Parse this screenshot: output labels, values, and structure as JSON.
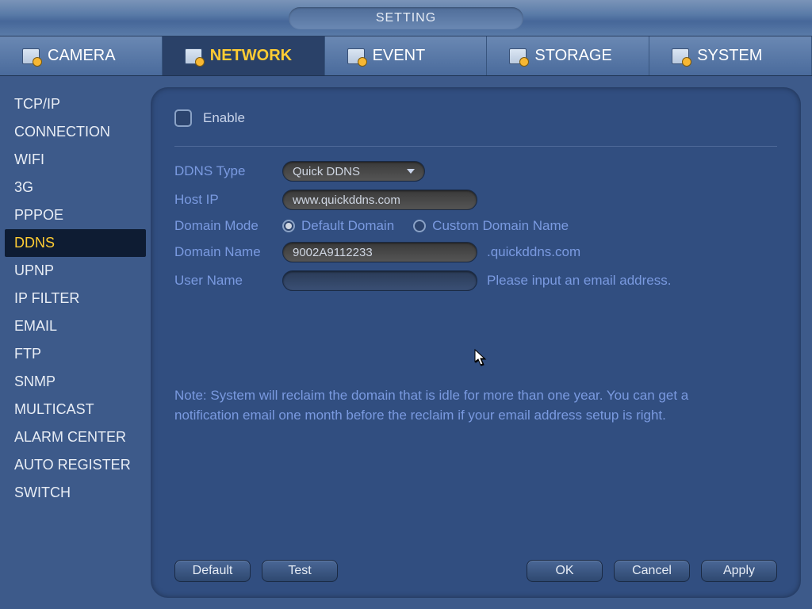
{
  "title": "SETTING",
  "tabs": [
    {
      "label": "CAMERA"
    },
    {
      "label": "NETWORK"
    },
    {
      "label": "EVENT"
    },
    {
      "label": "STORAGE"
    },
    {
      "label": "SYSTEM"
    }
  ],
  "active_tab": 1,
  "sidebar": {
    "items": [
      {
        "label": "TCP/IP"
      },
      {
        "label": "CONNECTION"
      },
      {
        "label": "WIFI"
      },
      {
        "label": "3G"
      },
      {
        "label": "PPPOE"
      },
      {
        "label": "DDNS"
      },
      {
        "label": "UPNP"
      },
      {
        "label": "IP FILTER"
      },
      {
        "label": "EMAIL"
      },
      {
        "label": "FTP"
      },
      {
        "label": "SNMP"
      },
      {
        "label": "MULTICAST"
      },
      {
        "label": "ALARM CENTER"
      },
      {
        "label": "AUTO REGISTER"
      },
      {
        "label": "SWITCH"
      }
    ],
    "active_index": 5
  },
  "form": {
    "enable_label": "Enable",
    "ddns_type_label": "DDNS Type",
    "ddns_type_value": "Quick DDNS",
    "host_ip_label": "Host IP",
    "host_ip_value": "www.quickddns.com",
    "domain_mode_label": "Domain Mode",
    "domain_mode_options": {
      "default": "Default Domain",
      "custom": "Custom Domain Name"
    },
    "domain_mode_selected": "default",
    "domain_name_label": "Domain Name",
    "domain_name_value": "9002A9112233",
    "domain_name_suffix": ".quickddns.com",
    "user_name_label": "User Name",
    "user_name_value": "",
    "user_name_hint": "Please input an email address."
  },
  "note": "Note: System will reclaim the domain that is idle for more than one year. You can get a notification email one month before the reclaim if your email address setup is right.",
  "buttons": {
    "default": "Default",
    "test": "Test",
    "ok": "OK",
    "cancel": "Cancel",
    "apply": "Apply"
  }
}
